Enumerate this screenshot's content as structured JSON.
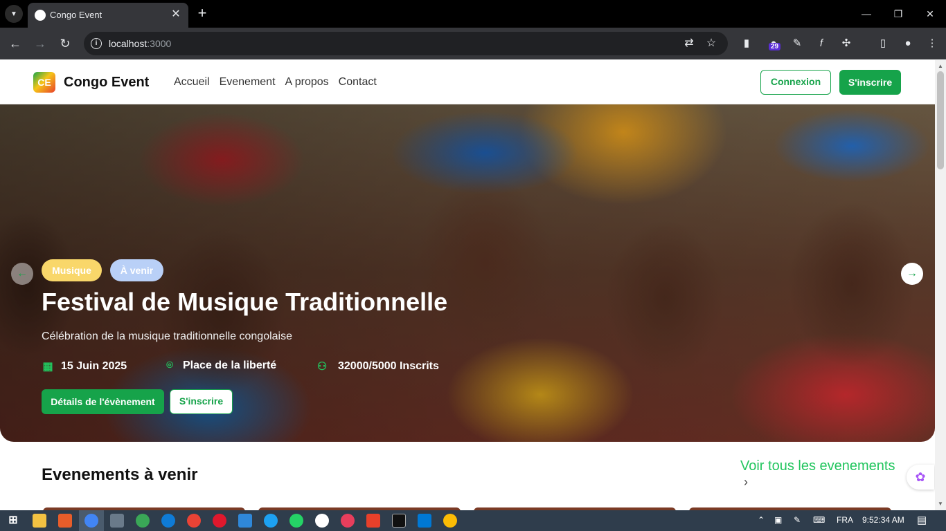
{
  "browser": {
    "tab_title": "Congo Event",
    "url_host": "localhost",
    "url_port": ":3000",
    "extension_badge": "29"
  },
  "site": {
    "logo_text": "CE",
    "name": "Congo Event",
    "nav": [
      {
        "label": "Accueil"
      },
      {
        "label": "Evenement"
      },
      {
        "label": "A propos"
      },
      {
        "label": "Contact"
      }
    ],
    "login_label": "Connexion",
    "signup_label": "S'inscrire"
  },
  "hero": {
    "tags": [
      "Musique",
      "À venir"
    ],
    "title": "Festival de Musique Traditionnelle",
    "subtitle": "Célébration de la musique traditionnelle congolaise",
    "date": "15 Juin 2025",
    "location": "Place de la liberté",
    "attendance": "32000/5000 Inscrits",
    "details_label": "Détails de l'évènement",
    "signup_label": "S'inscrire"
  },
  "upcoming": {
    "title": "Evenements à venir",
    "see_all": "Voir tous les evenements"
  },
  "taskbar": {
    "language": "FRA",
    "time": "9:52:34 AM"
  },
  "colors": {
    "accent": "#16a34a",
    "accent_light": "#22c55e",
    "tag_music": "#f9d76a",
    "tag_soon": "#b9d0f7"
  }
}
